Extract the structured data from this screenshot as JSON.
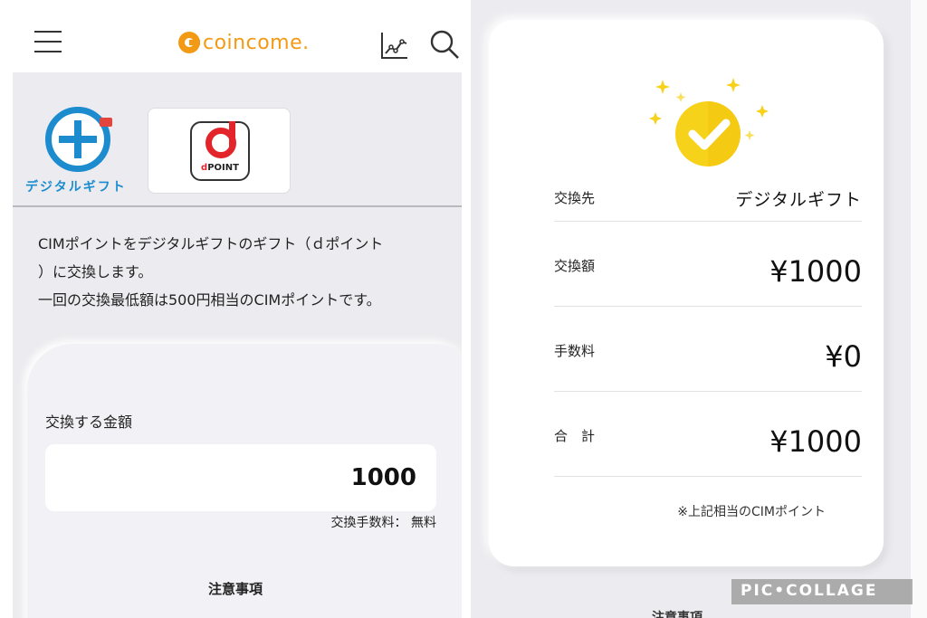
{
  "left_screen": {
    "header": {
      "logo_text": "coincome.",
      "menu_icon": "hamburger-menu-icon",
      "chart_icon": "line-chart-icon",
      "search_icon": "search-icon"
    },
    "brands": {
      "digital_gift_label": "デジタルギフト",
      "dpoint_label": "POINT",
      "dpoint_letter": "d"
    },
    "description": {
      "line1": "CIMポイントをデジタルギフトのギフト（ｄポイント",
      "line2": "）に交換します。",
      "line3": "一回の交換最低額は500円相当のCIMポイントです。"
    },
    "form": {
      "amount_label": "交換する金額",
      "amount_value": "1000",
      "fee_note": "交換手数料： 無料",
      "caution_title": "注意事項"
    }
  },
  "right_screen": {
    "success_icon": "check-circle-icon",
    "rows": [
      {
        "label": "交換先",
        "value": "デジタルギフト"
      },
      {
        "label": "交換額",
        "value": "¥1000"
      },
      {
        "label": "手数料",
        "value": "¥0"
      },
      {
        "label": "合　計",
        "value": "¥1000"
      }
    ],
    "footnote": "※上記相当のCIMポイント",
    "bottom_peek": "注意事項"
  },
  "watermark": "PIC•COLLAGE",
  "colors": {
    "brand_orange": "#f39a14",
    "gift_blue": "#1c8ccf",
    "dpoint_red": "#e3242b",
    "check_yellow": "#f7d21a",
    "background_gray": "#ececf0"
  }
}
